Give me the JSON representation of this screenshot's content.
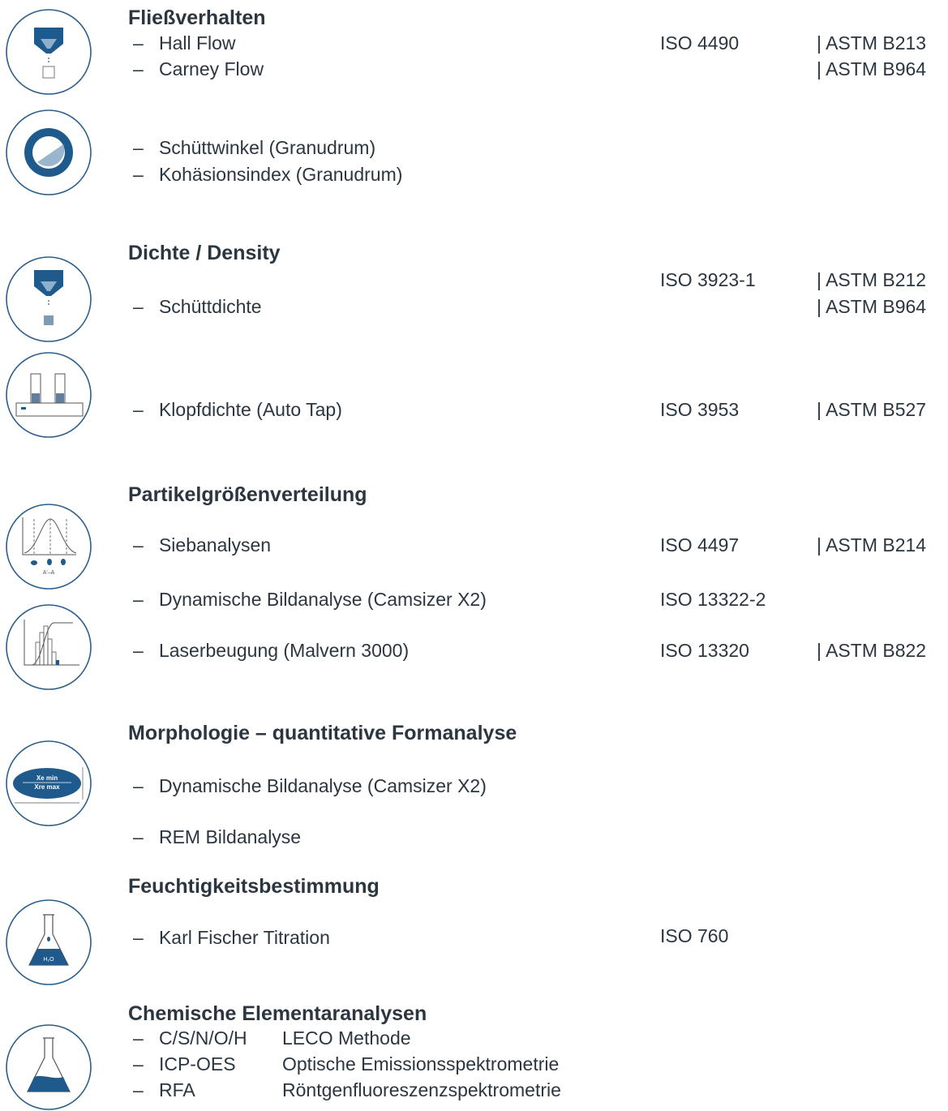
{
  "colors": {
    "accent": "#1e5a8c",
    "text": "#2b3640",
    "ring": "#2a5e8c"
  },
  "dash": "–",
  "sections": {
    "flow": {
      "title": "Fließverhalten",
      "items": [
        {
          "label": "Hall Flow",
          "iso": "ISO 4490",
          "astm": "| ASTM B213"
        },
        {
          "label": "Carney Flow",
          "astm": "| ASTM B964"
        },
        {
          "label": "Schüttwinkel (Granudrum)"
        },
        {
          "label": "Kohäsionsindex (Granudrum)"
        }
      ]
    },
    "density": {
      "title": "Dichte / Density",
      "iso_top": "ISO 3923-1",
      "astm_top": "| ASTM B212",
      "items": [
        {
          "label": "Schüttdichte",
          "astm": "| ASTM B964"
        },
        {
          "label": "Klopfdichte (Auto Tap)",
          "iso": "ISO 3953",
          "astm": "| ASTM B527"
        }
      ]
    },
    "psd": {
      "title": "Partikelgrößenverteilung",
      "items": [
        {
          "label": "Siebanalysen",
          "iso": "ISO 4497",
          "astm": "| ASTM B214"
        },
        {
          "label": "Dynamische Bildanalyse (Camsizer X2)",
          "iso": "ISO 13322-2"
        },
        {
          "label": "Laserbeugung (Malvern 3000)",
          "iso": "ISO 13320",
          "astm": "| ASTM B822"
        }
      ]
    },
    "morph": {
      "title": "Morphologie – quantitative Formanalyse",
      "items": [
        {
          "label": "Dynamische Bildanalyse (Camsizer X2)"
        },
        {
          "label": "REM Bildanalyse"
        }
      ]
    },
    "moisture": {
      "title": "Feuchtigkeitsbestimmung",
      "items": [
        {
          "label": "Karl Fischer Titration",
          "iso": "ISO 760"
        }
      ]
    },
    "chem": {
      "title": "Chemische Elementaranalysen",
      "items": [
        {
          "code": "C/S/N/O/H",
          "desc": "LECO Methode"
        },
        {
          "code": "ICP-OES",
          "desc": "Optische Emissionsspektrometrie"
        },
        {
          "code": "RFA",
          "desc": "Röntgenfluoreszenzspektrometrie"
        }
      ]
    }
  },
  "icon_text": {
    "sieve_label": "A'–A",
    "xe_min": "Xe min",
    "xre_max": "Xre max",
    "h2o": "H₂O"
  }
}
